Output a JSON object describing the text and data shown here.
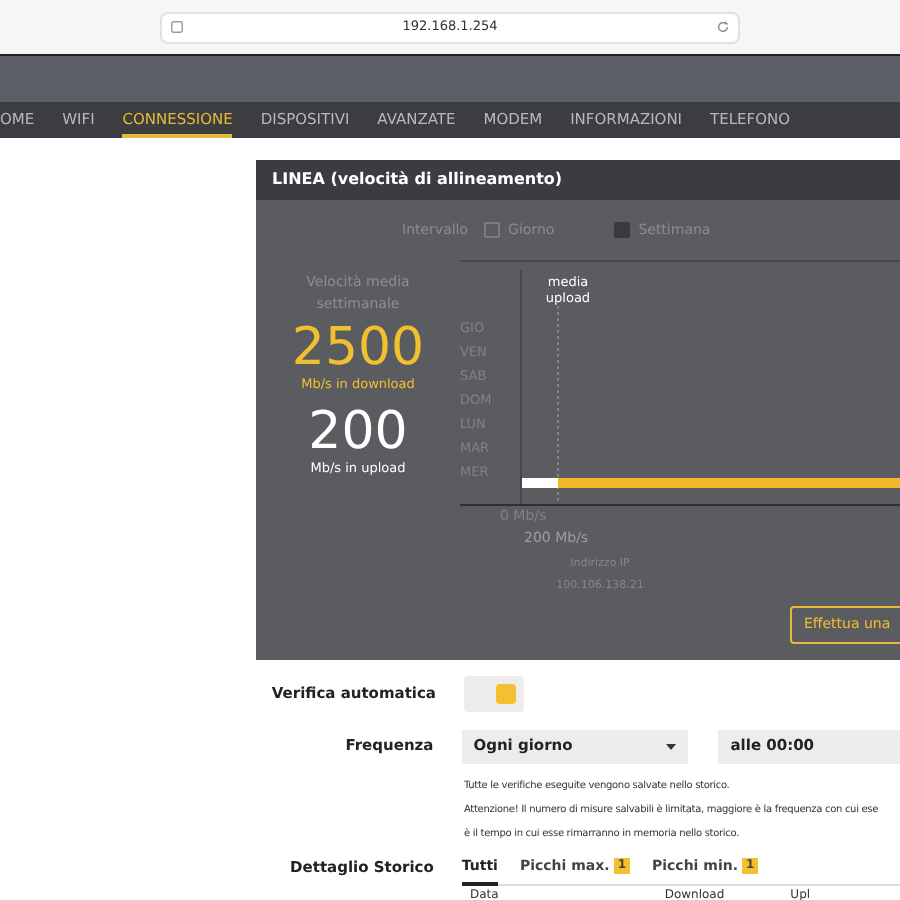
{
  "browser": {
    "url": "192.168.1.254"
  },
  "nav": [
    {
      "label": "OME",
      "selected": false
    },
    {
      "label": "WIFI",
      "selected": false
    },
    {
      "label": "CONNESSIONE",
      "selected": true
    },
    {
      "label": "DISPOSITIVI",
      "selected": false
    },
    {
      "label": "AVANZATE",
      "selected": false
    },
    {
      "label": "MODEM",
      "selected": false
    },
    {
      "label": "INFORMAZIONI",
      "selected": false
    },
    {
      "label": "TELEFONO",
      "selected": false
    }
  ],
  "panel": {
    "title": "LINEA (velocità di allineamento)",
    "interval": {
      "label": "Intervallo",
      "options": [
        {
          "label": "Giorno",
          "checked": false
        },
        {
          "label": "Settimana",
          "checked": true
        }
      ]
    },
    "stats": {
      "caption": "Velocità media settimanale",
      "download": "2500",
      "download_unit": "Mb/s in download",
      "upload": "200",
      "upload_unit": "Mb/s in upload"
    },
    "chart": {
      "marker": "media upload",
      "days": [
        "GIO",
        "VEN",
        "SAB",
        "DOM",
        "LUN",
        "MAR",
        "MER"
      ],
      "axis_min": "0 Mb/s",
      "marker_value": "200 Mb/s"
    },
    "ip_label": "Indirizzo IP",
    "ip": "100.106.138.21",
    "button": "Effettua una"
  },
  "settings": {
    "auto_label": "Verifica automatica",
    "auto_on": true,
    "freq_label": "Frequenza",
    "freq_value": "Ogni giorno",
    "time_value": "alle 00:00",
    "notes": [
      "Tutte le verifiche eseguite vengono salvate nello storico.",
      "Attenzione! Il numero di misure salvabili è limitata, maggiore è la frequenza con cui ese",
      "è il tempo in cui esse rimarranno in memoria nello storico."
    ]
  },
  "history": {
    "label": "Dettaglio Storico",
    "tabs": [
      {
        "label": "Tutti",
        "selected": true
      },
      {
        "label": "Picchi max.",
        "badge": "1",
        "selected": false
      },
      {
        "label": "Picchi min.",
        "badge": "1",
        "selected": false
      }
    ],
    "columns": [
      "Data",
      "Download",
      "Upl"
    ]
  }
}
